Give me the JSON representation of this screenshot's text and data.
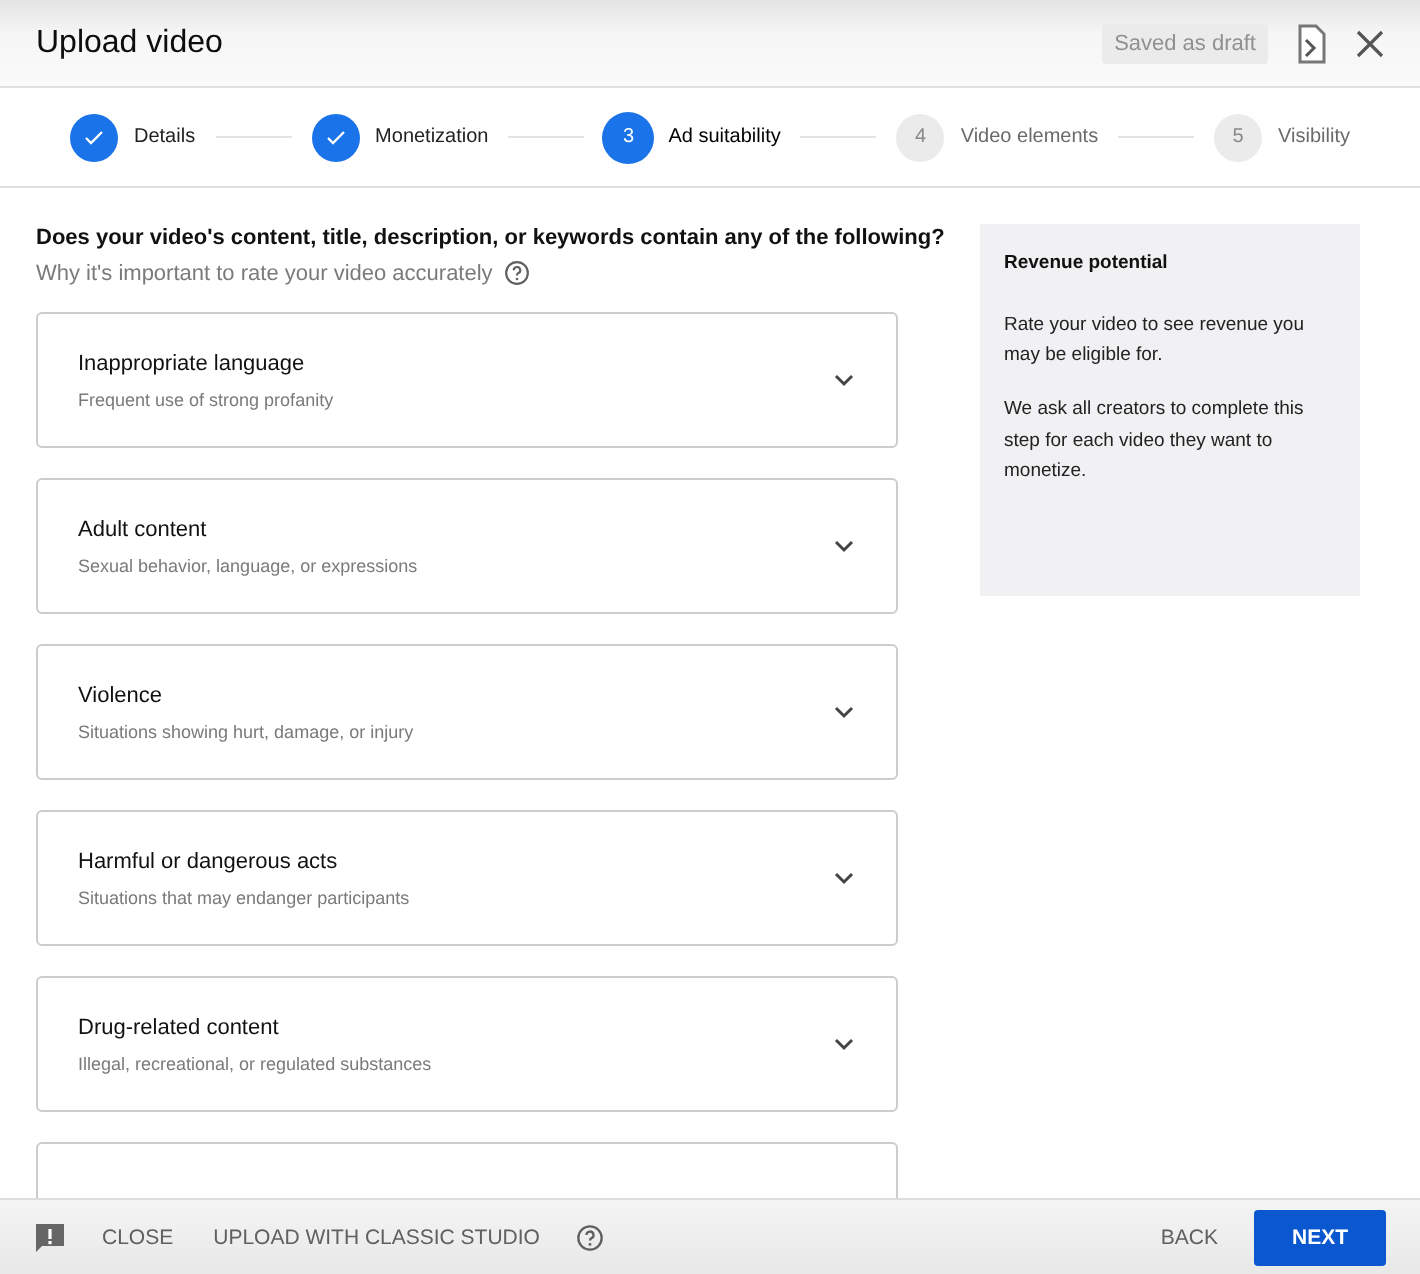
{
  "header": {
    "title": "Upload video",
    "save_status": "Saved as draft"
  },
  "steps": [
    {
      "label": "Details",
      "completed": true,
      "selected": false
    },
    {
      "label": "Monetization",
      "completed": true,
      "selected": false
    },
    {
      "label": "Ad suitability",
      "number": "3",
      "completed": false,
      "selected": true
    },
    {
      "label": "Video elements",
      "number": "4",
      "completed": false,
      "selected": false
    },
    {
      "label": "Visibility",
      "number": "5",
      "completed": false,
      "selected": false
    }
  ],
  "question": "Does your video's content, title, description, or keywords contain any of the following?",
  "help_link": "Why it's important to rate your video accurately",
  "categories": [
    {
      "title": "Inappropriate language",
      "description": "Frequent use of strong profanity",
      "expanded": false
    },
    {
      "title": "Adult content",
      "description": "Sexual behavior, language, or expressions",
      "expanded": false
    },
    {
      "title": "Violence",
      "description": "Situations showing hurt, damage, or injury",
      "expanded": false
    },
    {
      "title": "Harmful or dangerous acts",
      "description": "Situations that may endanger participants",
      "expanded": false
    },
    {
      "title": "Drug-related content",
      "description": "Illegal, recreational, or regulated substances",
      "expanded": false
    }
  ],
  "side_panel": {
    "title": "Revenue potential",
    "paragraphs": [
      "Rate your video to see revenue you may be eligible for.",
      "We ask all creators to complete this step for each video they want to monetize."
    ]
  },
  "footer": {
    "close": "CLOSE",
    "classic": "UPLOAD WITH CLASSIC STUDIO",
    "back": "BACK",
    "next": "NEXT"
  }
}
